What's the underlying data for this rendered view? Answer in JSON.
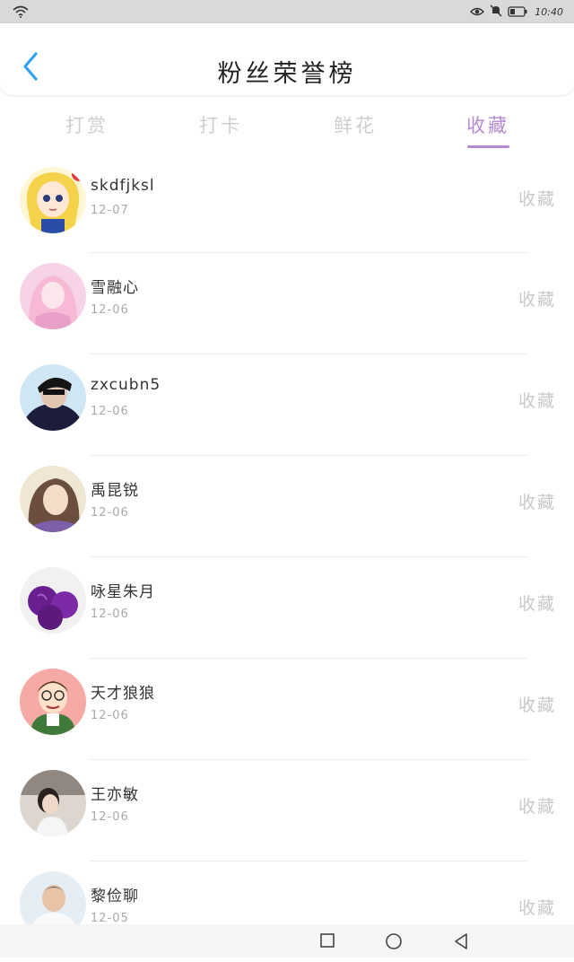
{
  "status_bar": {
    "time": "10:40",
    "icons": [
      "wifi-icon",
      "eye-icon",
      "mute-icon",
      "battery-icon"
    ]
  },
  "header": {
    "title": "粉丝荣誉榜",
    "back_icon": "chevron-left-icon"
  },
  "tabs": [
    {
      "label": "打赏",
      "active": false
    },
    {
      "label": "打卡",
      "active": false
    },
    {
      "label": "鲜花",
      "active": false
    },
    {
      "label": "收藏",
      "active": true
    }
  ],
  "list": [
    {
      "name": "skdfjksl",
      "date": "12-07",
      "action": "收藏"
    },
    {
      "name": "雪融心",
      "date": "12-06",
      "action": "收藏"
    },
    {
      "name": "zxcubn5",
      "date": "12-06",
      "action": "收藏"
    },
    {
      "name": "禹昆锐",
      "date": "12-06",
      "action": "收藏"
    },
    {
      "name": "咏星朱月",
      "date": "12-06",
      "action": "收藏"
    },
    {
      "name": "天才狼狼",
      "date": "12-06",
      "action": "收藏"
    },
    {
      "name": "王亦敏",
      "date": "12-06",
      "action": "收藏"
    },
    {
      "name": "黎俭聊",
      "date": "12-05",
      "action": "收藏"
    }
  ],
  "colors": {
    "accent": "#b48ad3",
    "back_arrow": "#2ea3f2",
    "inactive_tab": "#cfcfcf",
    "date_text": "#a9a9a9"
  },
  "nav_bar": [
    "square-icon",
    "circle-icon",
    "triangle-back-icon"
  ]
}
